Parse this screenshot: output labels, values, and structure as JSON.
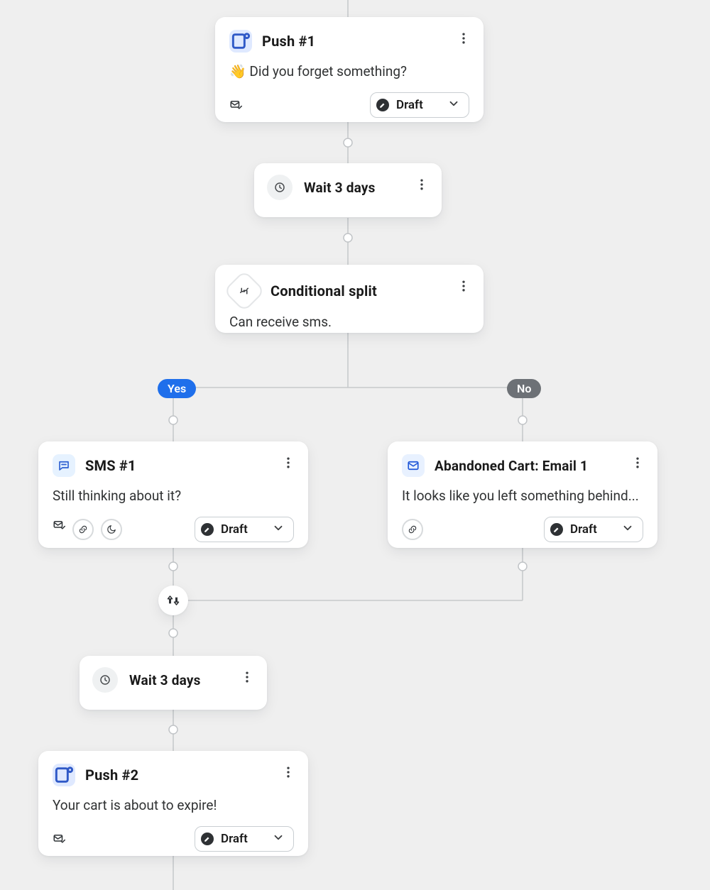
{
  "branches": {
    "yes": "Yes",
    "no": "No"
  },
  "nodes": {
    "push1": {
      "title": "Push #1",
      "body": " Did you forget something?",
      "status": "Draft"
    },
    "wait1": {
      "title": "Wait 3 days"
    },
    "split": {
      "title": "Conditional split",
      "body": "Can receive sms."
    },
    "sms1": {
      "title": "SMS #1",
      "body": "Still thinking about it?",
      "status": "Draft"
    },
    "email1": {
      "title": "Abandoned Cart: Email 1",
      "body": "It looks like you left something behind...",
      "status": "Draft"
    },
    "wait2": {
      "title": "Wait 3 days"
    },
    "push2": {
      "title": "Push #2",
      "body": "Your cart is about to expire!",
      "status": "Draft"
    }
  }
}
